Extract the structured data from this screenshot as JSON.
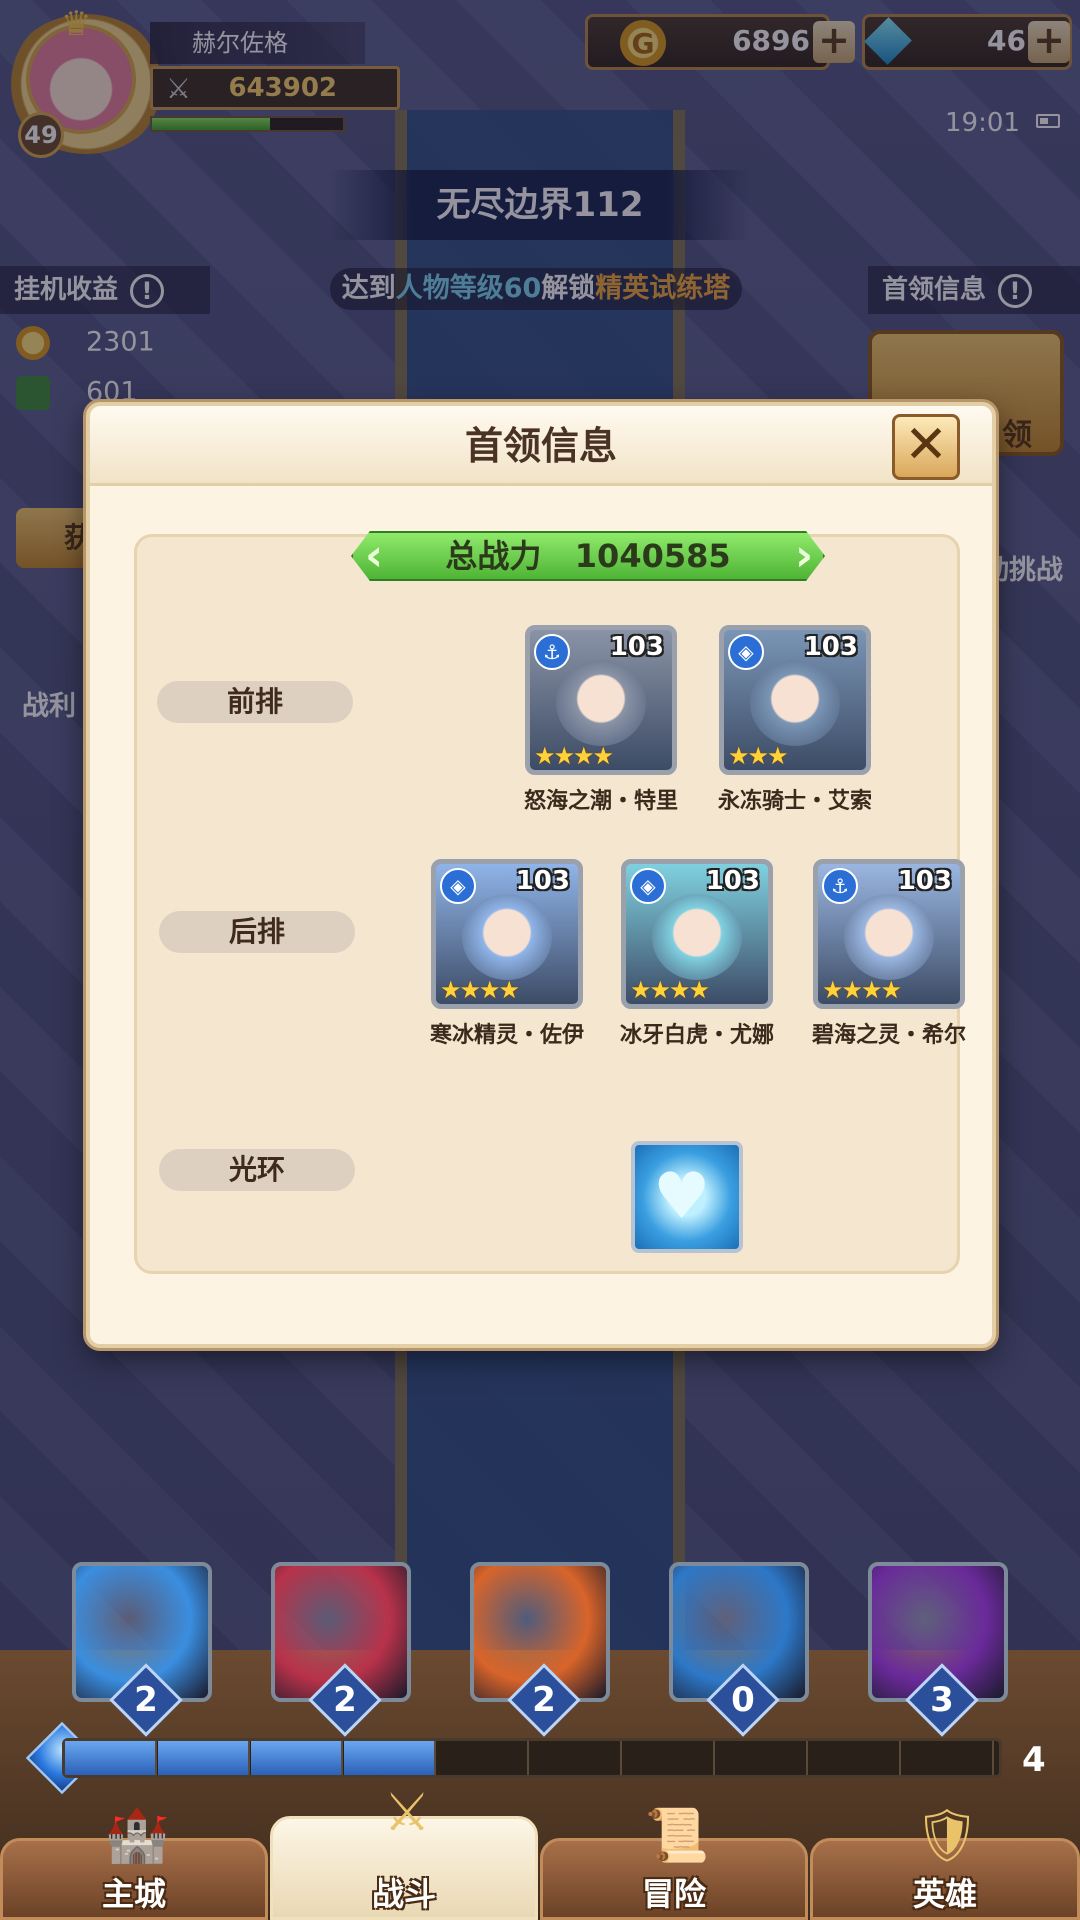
{
  "player": {
    "name": "赫尔佐格",
    "level": "49",
    "power": "643902",
    "exp_fraction": 0.62
  },
  "resources": {
    "gold": "6896",
    "gems": "46",
    "plus_label": "+",
    "gold_icon": "gold-coin-icon",
    "gem_icon": "diamond-icon"
  },
  "status": {
    "time": "19:01"
  },
  "stage": {
    "title": "无尽边界112",
    "unlock_prefix": "达到",
    "unlock_highlight1": "人物等级60",
    "unlock_mid": "解锁",
    "unlock_highlight2": "精英试练塔"
  },
  "idle": {
    "title": "挂机收益",
    "info": "!",
    "gold": "2301",
    "exp": "601",
    "get_label": "获"
  },
  "boss_side": {
    "title": "首领信息",
    "info": "!",
    "button_label": "领",
    "auto_challenge": "动挑战",
    "loot_label": "战利"
  },
  "modal": {
    "title": "首领信息",
    "close": "✕",
    "total_power_label": "总战力",
    "total_power_value": "1040585",
    "front_label": "前排",
    "back_label": "后排",
    "aura_label": "光环",
    "front_heroes": [
      {
        "name": "怒海之潮・特里",
        "level": "103",
        "stars": 4,
        "type_icon": "anchor-icon",
        "color": "#8a93a6"
      },
      {
        "name": "永冻骑士・艾索",
        "level": "103",
        "stars": 3,
        "type_icon": "shield-icon",
        "color": "#7a95b5"
      }
    ],
    "back_heroes": [
      {
        "name": "寒冰精灵・佐伊",
        "level": "103",
        "stars": 4,
        "type_icon": "shield-icon",
        "color": "#8fb4e8"
      },
      {
        "name": "冰牙白虎・尤娜",
        "level": "103",
        "stars": 4,
        "type_icon": "shield-icon",
        "color": "#7fd0e0"
      },
      {
        "name": "碧海之灵・希尔",
        "level": "103",
        "stars": 4,
        "type_icon": "anchor-icon",
        "color": "#9ab6e0"
      }
    ],
    "aura_icon": "ice-heart-icon"
  },
  "skills": [
    {
      "count": "2",
      "icon": "lightning-sword-icon",
      "color": "#3a8ee0"
    },
    {
      "count": "2",
      "icon": "crimson-slash-icon",
      "color": "#b8324a"
    },
    {
      "count": "2",
      "icon": "fire-potion-icon",
      "color": "#d8642a"
    },
    {
      "count": "0",
      "icon": "ice-phoenix-icon",
      "color": "#2d78c8"
    },
    {
      "count": "3",
      "icon": "void-moon-icon",
      "color": "#6a2a9a"
    }
  ],
  "energy": {
    "filled": 4,
    "total": 10,
    "count": "4"
  },
  "nav": [
    {
      "label": "主城",
      "icon": "castle-icon"
    },
    {
      "label": "战斗",
      "icon": "crossed-swords-icon"
    },
    {
      "label": "冒险",
      "icon": "map-scroll-icon"
    },
    {
      "label": "英雄",
      "icon": "hero-crest-icon"
    }
  ],
  "colors": {
    "accent_green": "#5cc43c",
    "highlight_blue": "#7fd6f2",
    "highlight_gold": "#f2a93b",
    "modal_bg": "#fdf3e2"
  }
}
